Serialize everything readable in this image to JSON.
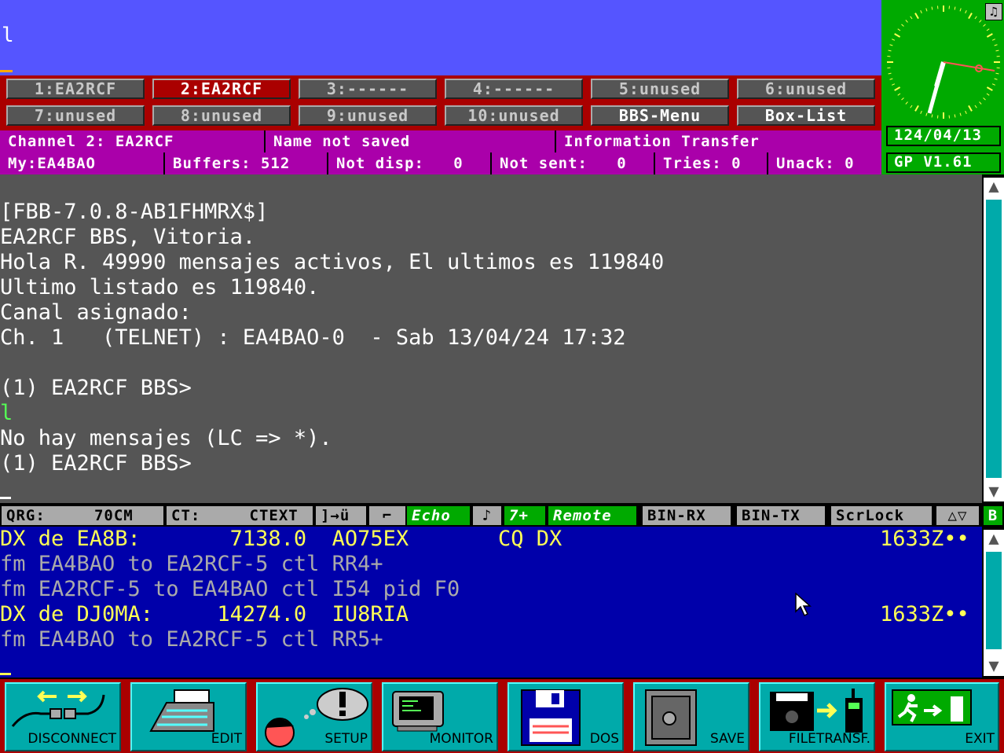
{
  "input": {
    "text": "l"
  },
  "clock": {
    "date": "124/04/13",
    "version": "GP V1.61",
    "note_icon": "♫"
  },
  "channels": [
    {
      "label": "1:EA2RCF",
      "state": "normal"
    },
    {
      "label": "2:EA2RCF",
      "state": "active"
    },
    {
      "label": "3:------",
      "state": "normal"
    },
    {
      "label": "4:------",
      "state": "normal"
    },
    {
      "label": "5:unused",
      "state": "normal"
    },
    {
      "label": "6:unused",
      "state": "normal"
    },
    {
      "label": "7:unused",
      "state": "normal"
    },
    {
      "label": "8:unused",
      "state": "normal"
    },
    {
      "label": "9:unused",
      "state": "normal"
    },
    {
      "label": "10:unused",
      "state": "normal"
    },
    {
      "label": "BBS-Menu",
      "state": "normal"
    },
    {
      "label": "Box-List",
      "state": "normal"
    }
  ],
  "status1": {
    "channel": "Channel 2: EA2RCF",
    "name": "Name not saved",
    "info": "Information Transfer"
  },
  "status2": {
    "my": "My:EA4BAO",
    "buffers": "Buffers: 512",
    "not_disp": "Not disp:   0",
    "not_sent": "Not sent:   0",
    "tries": "Tries: 0",
    "unack": "Unack: 0"
  },
  "terminal": {
    "lines": [
      "[FBB-7.0.8-AB1FHMRX$]",
      "EA2RCF BBS, Vitoria.",
      "Hola R. 49990 mensajes activos, El ultimos es 119840",
      "Ultimo listado es 119840.",
      "Canal asignado:",
      "Ch. 1   (TELNET) : EA4BAO-0  - Sab 13/04/24 17:32",
      "",
      "(1) EA2RCF BBS>",
      "l",
      "No hay mensajes (LC => *).",
      "(1) EA2RCF BBS>"
    ]
  },
  "statusbar": {
    "qrg": "QRG:     70CM",
    "ct": "CT:     CTEXT",
    "conv": "]→ü",
    "echo": "Echo",
    "seven": "7+",
    "remote": "Remote",
    "binrx": "BIN-RX",
    "bintx": "BIN-TX",
    "scrlock": "ScrLock",
    "b": "B"
  },
  "monitor": {
    "lines": [
      {
        "text": "DX de EA8B:       7138.0  AO75EX       CQ DX",
        "right": "1633Z••",
        "color": "yellow"
      },
      {
        "text": "fm EA4BAO to EA2RCF-5 ctl RR4+",
        "right": "",
        "color": "gray"
      },
      {
        "text": "fm EA2RCF-5 to EA4BAO ctl I54 pid F0",
        "right": "",
        "color": "gray"
      },
      {
        "text": "DX de DJ0MA:     14274.0  IU8RIA",
        "right": "1633Z••",
        "color": "yellow"
      },
      {
        "text": "fm EA4BAO to EA2RCF-5 ctl RR5+",
        "right": "",
        "color": "gray"
      }
    ]
  },
  "toolbar": [
    {
      "label": "DISCONNECT",
      "icon": "disconnect-icon"
    },
    {
      "label": "EDIT",
      "icon": "typewriter-icon"
    },
    {
      "label": "SETUP",
      "icon": "setup-icon"
    },
    {
      "label": "MONITOR",
      "icon": "monitor-icon"
    },
    {
      "label": "DOS",
      "icon": "floppy-icon"
    },
    {
      "label": "SAVE",
      "icon": "safe-icon"
    },
    {
      "label": "FILETRANSF.",
      "icon": "filetransfer-icon"
    },
    {
      "label": "EXIT",
      "icon": "exit-icon"
    }
  ]
}
